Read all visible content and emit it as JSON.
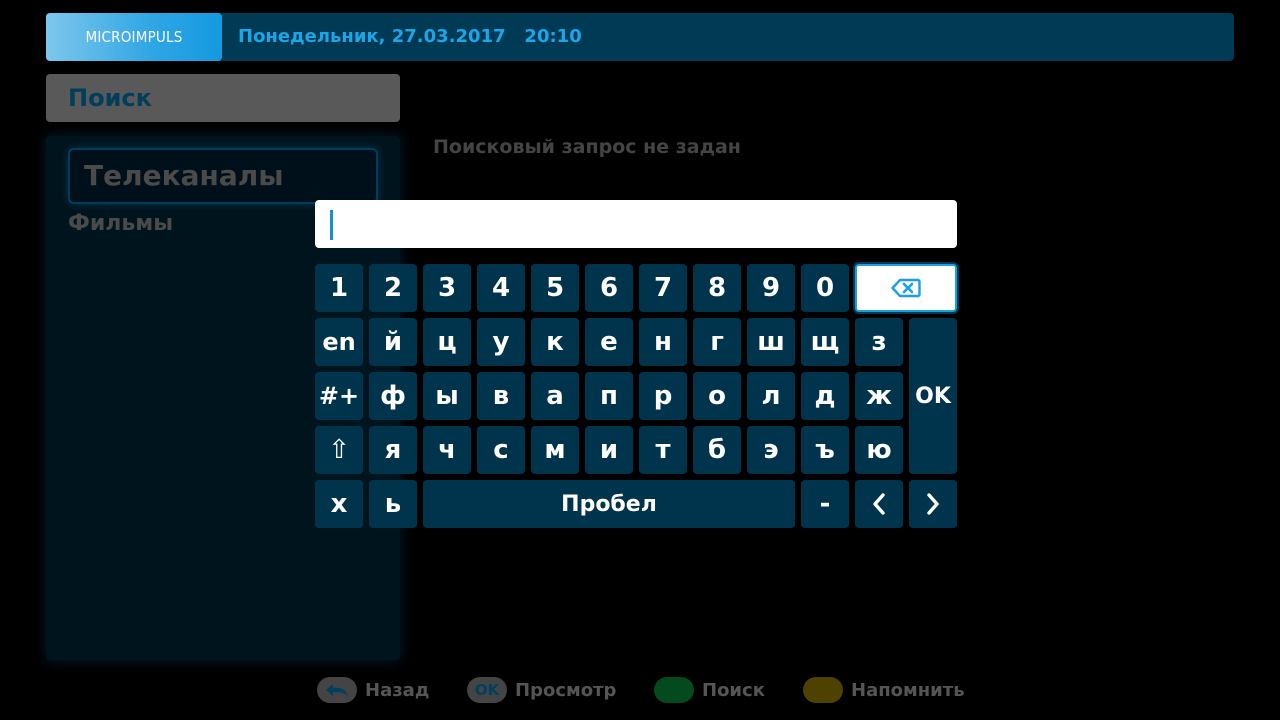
{
  "header": {
    "logo": "MICROIMPULS",
    "datetime": "Понедельник, 27.03.2017   20:10"
  },
  "section_title": "Поиск",
  "categories": [
    {
      "label": "Телеканалы",
      "selected": true
    },
    {
      "label": "Фильмы",
      "selected": false
    }
  ],
  "query_status": "Поисковый запрос не задан",
  "search_input": {
    "value": ""
  },
  "keyboard": {
    "row1": [
      "1",
      "2",
      "3",
      "4",
      "5",
      "6",
      "7",
      "8",
      "9",
      "0"
    ],
    "row2": [
      "en",
      "й",
      "ц",
      "у",
      "к",
      "е",
      "н",
      "г",
      "ш",
      "щ",
      "з"
    ],
    "row3": [
      "#+",
      "ф",
      "ы",
      "в",
      "а",
      "п",
      "р",
      "о",
      "л",
      "д",
      "ж"
    ],
    "row4": [
      "⇧",
      "я",
      "ч",
      "с",
      "м",
      "и",
      "т",
      "б",
      "э",
      "ъ",
      "ю"
    ],
    "row5": [
      "x",
      "ь"
    ],
    "space": "Пробел",
    "dash": "-",
    "ok": "OK",
    "backspace_icon": "backspace-icon",
    "prev_icon": "chevron-left-icon",
    "next_icon": "chevron-right-icon"
  },
  "footer": {
    "back": "Назад",
    "ok_badge": "OK",
    "view": "Просмотр",
    "search": "Поиск",
    "remind": "Напомнить"
  },
  "colors": {
    "accent": "#1aa6e8",
    "key_bg": "#00344d",
    "header_bg": "#003a55",
    "green": "#034a1c",
    "yellow": "#4d4200"
  }
}
